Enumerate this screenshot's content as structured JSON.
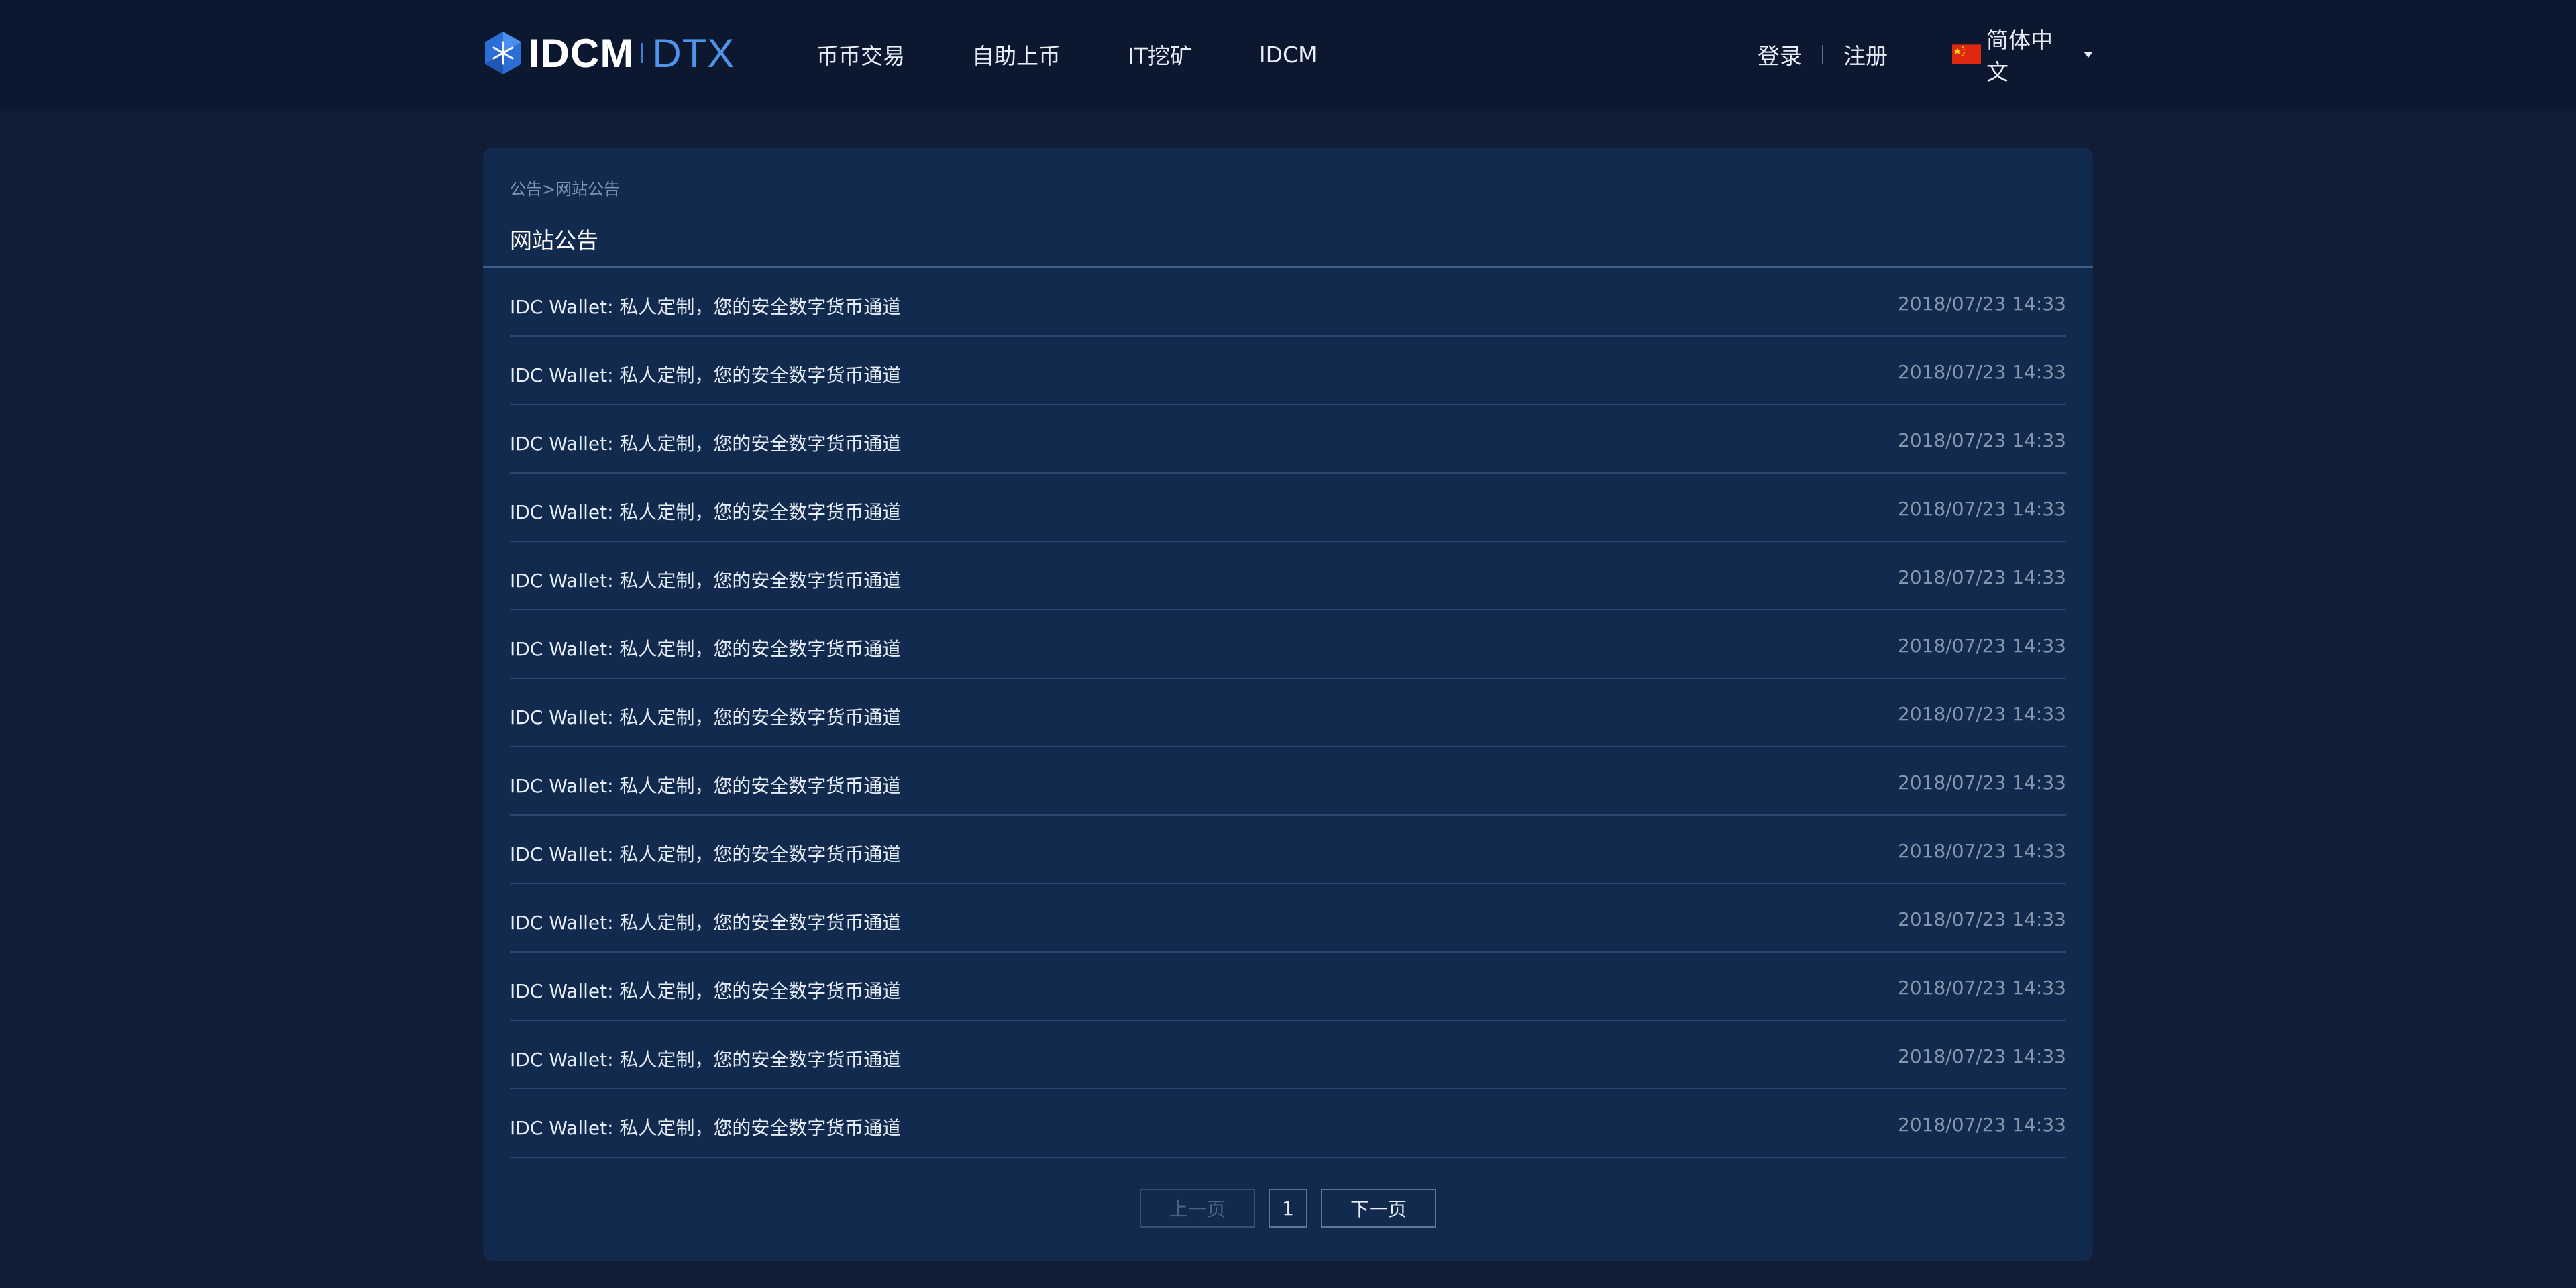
{
  "header": {
    "logo": {
      "brand": "IDCM",
      "product": "DTX"
    },
    "nav": [
      "币币交易",
      "自助上币",
      "IT挖矿",
      "IDCM"
    ],
    "login_label": "登录",
    "register_label": "注册",
    "language": {
      "label": "简体中文",
      "flag": "china-flag-icon"
    }
  },
  "colors": {
    "background": "#0f1d36",
    "header": "#0b1830",
    "card": "#112a4e",
    "accent": "#4f94ea"
  },
  "breadcrumb": {
    "root": "公告",
    "separator": ">",
    "current": "网站公告"
  },
  "page_title": "网站公告",
  "announcements": [
    {
      "title": "IDC Wallet: 私人定制，您的安全数字货币通道",
      "date": "2018/07/23 14:33"
    },
    {
      "title": "IDC Wallet: 私人定制，您的安全数字货币通道",
      "date": "2018/07/23 14:33"
    },
    {
      "title": "IDC Wallet: 私人定制，您的安全数字货币通道",
      "date": "2018/07/23 14:33"
    },
    {
      "title": "IDC Wallet: 私人定制，您的安全数字货币通道",
      "date": "2018/07/23 14:33"
    },
    {
      "title": "IDC Wallet: 私人定制，您的安全数字货币通道",
      "date": "2018/07/23 14:33"
    },
    {
      "title": "IDC Wallet: 私人定制，您的安全数字货币通道",
      "date": "2018/07/23 14:33"
    },
    {
      "title": "IDC Wallet: 私人定制，您的安全数字货币通道",
      "date": "2018/07/23 14:33"
    },
    {
      "title": "IDC Wallet: 私人定制，您的安全数字货币通道",
      "date": "2018/07/23 14:33"
    },
    {
      "title": "IDC Wallet: 私人定制，您的安全数字货币通道",
      "date": "2018/07/23 14:33"
    },
    {
      "title": "IDC Wallet: 私人定制，您的安全数字货币通道",
      "date": "2018/07/23 14:33"
    },
    {
      "title": "IDC Wallet: 私人定制，您的安全数字货币通道",
      "date": "2018/07/23 14:33"
    },
    {
      "title": "IDC Wallet: 私人定制，您的安全数字货币通道",
      "date": "2018/07/23 14:33"
    },
    {
      "title": "IDC Wallet: 私人定制，您的安全数字货币通道",
      "date": "2018/07/23 14:33"
    }
  ],
  "pagination": {
    "prev_label": "上一页",
    "current_page": "1",
    "next_label": "下一页"
  }
}
